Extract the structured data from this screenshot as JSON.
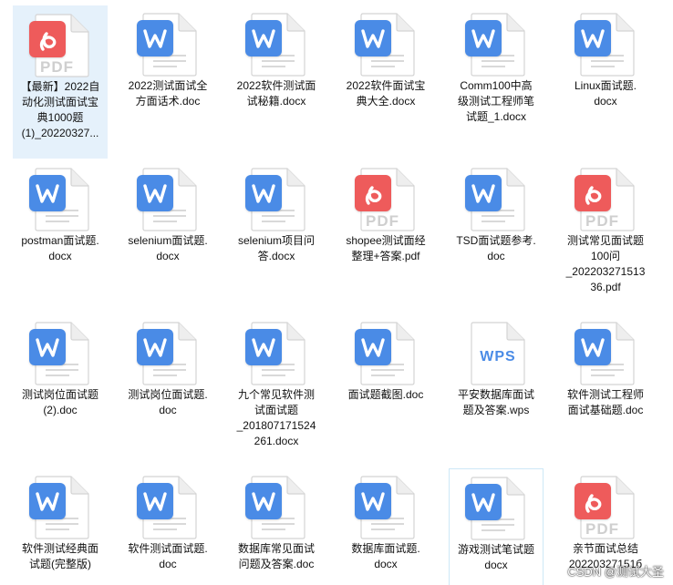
{
  "files": [
    {
      "name": "【最新】2022自\n动化测试面试宝\n典1000题\n(1)_20220327...",
      "type": "pdf",
      "state": "selected"
    },
    {
      "name": "2022测试面试全\n方面话术.doc",
      "type": "doc",
      "state": "normal"
    },
    {
      "name": "2022软件测试面\n试秘籍.docx",
      "type": "word",
      "state": "normal"
    },
    {
      "name": "2022软件面试宝\n典大全.docx",
      "type": "word",
      "state": "normal"
    },
    {
      "name": "Comm100中高\n级测试工程师笔\n试题_1.docx",
      "type": "word",
      "state": "normal"
    },
    {
      "name": "Linux面试题.\ndocx",
      "type": "word",
      "state": "normal"
    },
    {
      "name": "postman面试题.\ndocx",
      "type": "word",
      "state": "normal"
    },
    {
      "name": "selenium面试题.\ndocx",
      "type": "word",
      "state": "normal"
    },
    {
      "name": "selenium项目问\n答.docx",
      "type": "word",
      "state": "normal"
    },
    {
      "name": "shopee测试面经\n整理+答案.pdf",
      "type": "pdf",
      "state": "normal"
    },
    {
      "name": "TSD面试题参考.\ndoc",
      "type": "doc",
      "state": "normal"
    },
    {
      "name": "测试常见面试题\n100问\n_202203271513\n36.pdf",
      "type": "pdf",
      "state": "normal"
    },
    {
      "name": "测试岗位面试题\n(2).doc",
      "type": "doc",
      "state": "normal"
    },
    {
      "name": "测试岗位面试题.\ndoc",
      "type": "doc",
      "state": "normal"
    },
    {
      "name": "九个常见软件测\n试面试题\n_201807171524\n261.docx",
      "type": "word",
      "state": "normal"
    },
    {
      "name": "面试题截图.doc",
      "type": "doc",
      "state": "normal"
    },
    {
      "name": "平安数据库面试\n题及答案.wps",
      "type": "wps",
      "state": "normal"
    },
    {
      "name": "软件测试工程师\n面试基础题.doc",
      "type": "doc",
      "state": "normal"
    },
    {
      "name": "软件测试经典面\n试题(完整版)",
      "type": "doc",
      "state": "normal"
    },
    {
      "name": "软件测试面试题.\ndoc",
      "type": "doc",
      "state": "normal"
    },
    {
      "name": "数据库常见面试\n问题及答案.doc",
      "type": "doc",
      "state": "normal"
    },
    {
      "name": "数据库面试题.\ndocx",
      "type": "word",
      "state": "normal"
    },
    {
      "name": "游戏测试笔试题\ndocx",
      "type": "word",
      "state": "hover"
    },
    {
      "name": "亲节面试总结\n20220327151б",
      "type": "pdf",
      "state": "normal"
    }
  ],
  "icons": {
    "word": {
      "semantic": "word-document-icon",
      "color": "#4a8be6"
    },
    "doc": {
      "semantic": "doc-document-icon",
      "color": "#4a8be6"
    },
    "pdf": {
      "semantic": "pdf-document-icon",
      "color": "#ee5b5b",
      "label": "PDF"
    },
    "wps": {
      "semantic": "wps-document-icon",
      "color": "#4a8be6",
      "label": "WPS"
    }
  },
  "watermark": "CSDN @测试大圣"
}
